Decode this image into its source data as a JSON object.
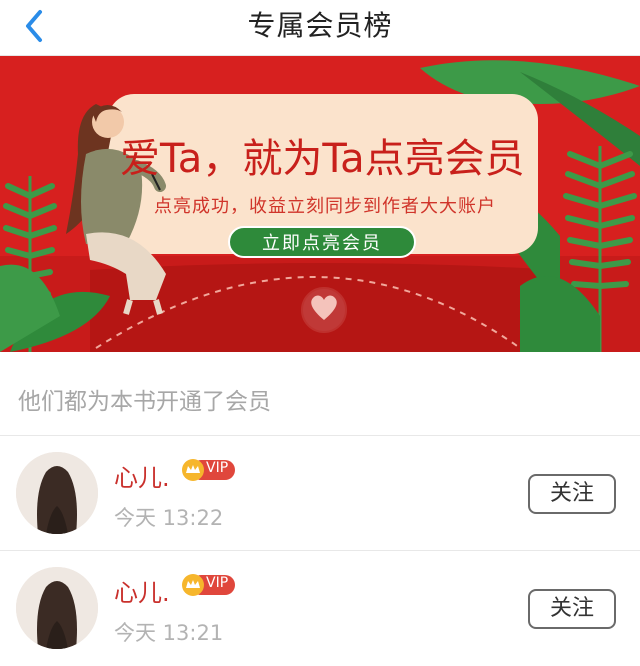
{
  "header": {
    "title": "专属会员榜",
    "back_icon": "chevron-left-icon",
    "back_color": "#2a8ce8"
  },
  "banner": {
    "headline": "爱Ta，就为Ta点亮会员",
    "subline": "点亮成功，收益立刻同步到作者大大账户",
    "cta_label": "立即点亮会员",
    "colors": {
      "background": "#d7201f",
      "card": "#fbe3cc",
      "cta": "#2e8a3a",
      "leaf": "#3d9a48"
    }
  },
  "section": {
    "label": "他们都为本书开通了会员"
  },
  "members": [
    {
      "name": "心儿.",
      "badge": "VIP",
      "time": "今天 13:22",
      "follow_label": "关注"
    },
    {
      "name": "心儿.",
      "badge": "VIP",
      "time": "今天 13:21",
      "follow_label": "关注"
    }
  ]
}
